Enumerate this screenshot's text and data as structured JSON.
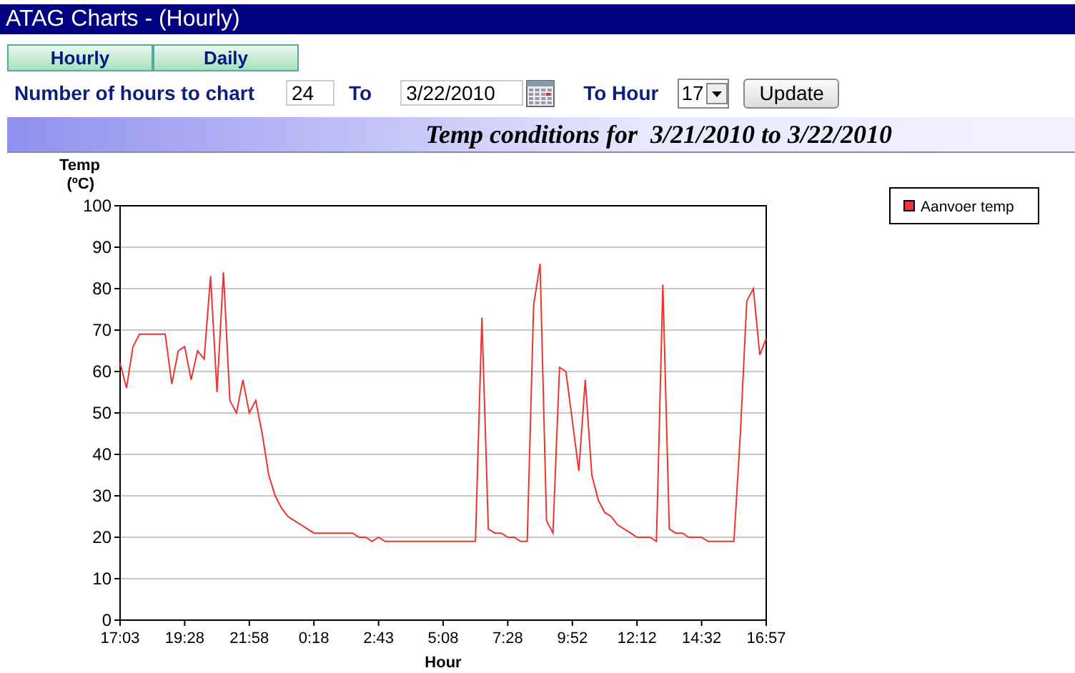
{
  "window": {
    "title": "ATAG Charts - (Hourly)"
  },
  "tabs": [
    {
      "label": "Hourly",
      "selected": false
    },
    {
      "label": "Daily",
      "selected": false
    }
  ],
  "controls": {
    "hours_label": "Number of hours to chart",
    "hours_value": "24",
    "to_label": "To",
    "date_value": "3/22/2010",
    "to_hour_label": "To Hour",
    "hour_value": "17",
    "update_button": "Update"
  },
  "chart_header": "Temp conditions for  3/21/2010 to 3/22/2010",
  "chart": {
    "chart_data": {
      "type": "line",
      "grid": true,
      "ylabel": "Temp\n(ºC)",
      "xlabel": "Hour",
      "ylim": [
        0,
        100
      ],
      "yticks": [
        0,
        10,
        20,
        30,
        40,
        50,
        60,
        70,
        80,
        90,
        100
      ],
      "categories": [
        "17:03",
        null,
        null,
        null,
        null,
        null,
        null,
        null,
        null,
        null,
        "19:28",
        null,
        null,
        null,
        null,
        null,
        null,
        null,
        null,
        null,
        "21:58",
        null,
        null,
        null,
        null,
        null,
        null,
        null,
        null,
        null,
        "0:18",
        null,
        null,
        null,
        null,
        null,
        null,
        null,
        null,
        null,
        "2:43",
        null,
        null,
        null,
        null,
        null,
        null,
        null,
        null,
        null,
        "5:08",
        null,
        null,
        null,
        null,
        null,
        null,
        null,
        null,
        null,
        "7:28",
        null,
        null,
        null,
        null,
        null,
        null,
        null,
        null,
        null,
        "9:52",
        null,
        null,
        null,
        null,
        null,
        null,
        null,
        null,
        null,
        "12:12",
        null,
        null,
        null,
        null,
        null,
        null,
        null,
        null,
        null,
        "14:32",
        null,
        null,
        null,
        null,
        null,
        null,
        null,
        null,
        null,
        "16:57"
      ],
      "series": [
        {
          "name": "Aanvoer temp",
          "color": "#ee3333",
          "values": [
            62,
            56,
            66,
            69,
            69,
            69,
            69,
            69,
            57,
            65,
            66,
            58,
            65,
            63,
            83,
            55,
            84,
            53,
            50,
            58,
            50,
            53,
            45,
            35,
            30,
            27,
            25,
            24,
            23,
            22,
            21,
            21,
            21,
            21,
            21,
            21,
            21,
            20,
            20,
            19,
            20,
            19,
            19,
            19,
            19,
            19,
            19,
            19,
            19,
            19,
            19,
            19,
            19,
            19,
            19,
            19,
            73,
            22,
            21,
            21,
            20,
            20,
            19,
            19,
            76,
            86,
            24,
            21,
            61,
            60,
            48,
            36,
            58,
            35,
            29,
            26,
            25,
            23,
            22,
            21,
            20,
            20,
            20,
            19,
            81,
            22,
            21,
            21,
            20,
            20,
            20,
            19,
            19,
            19,
            19,
            19,
            45,
            77,
            80,
            64,
            68
          ]
        }
      ]
    }
  }
}
